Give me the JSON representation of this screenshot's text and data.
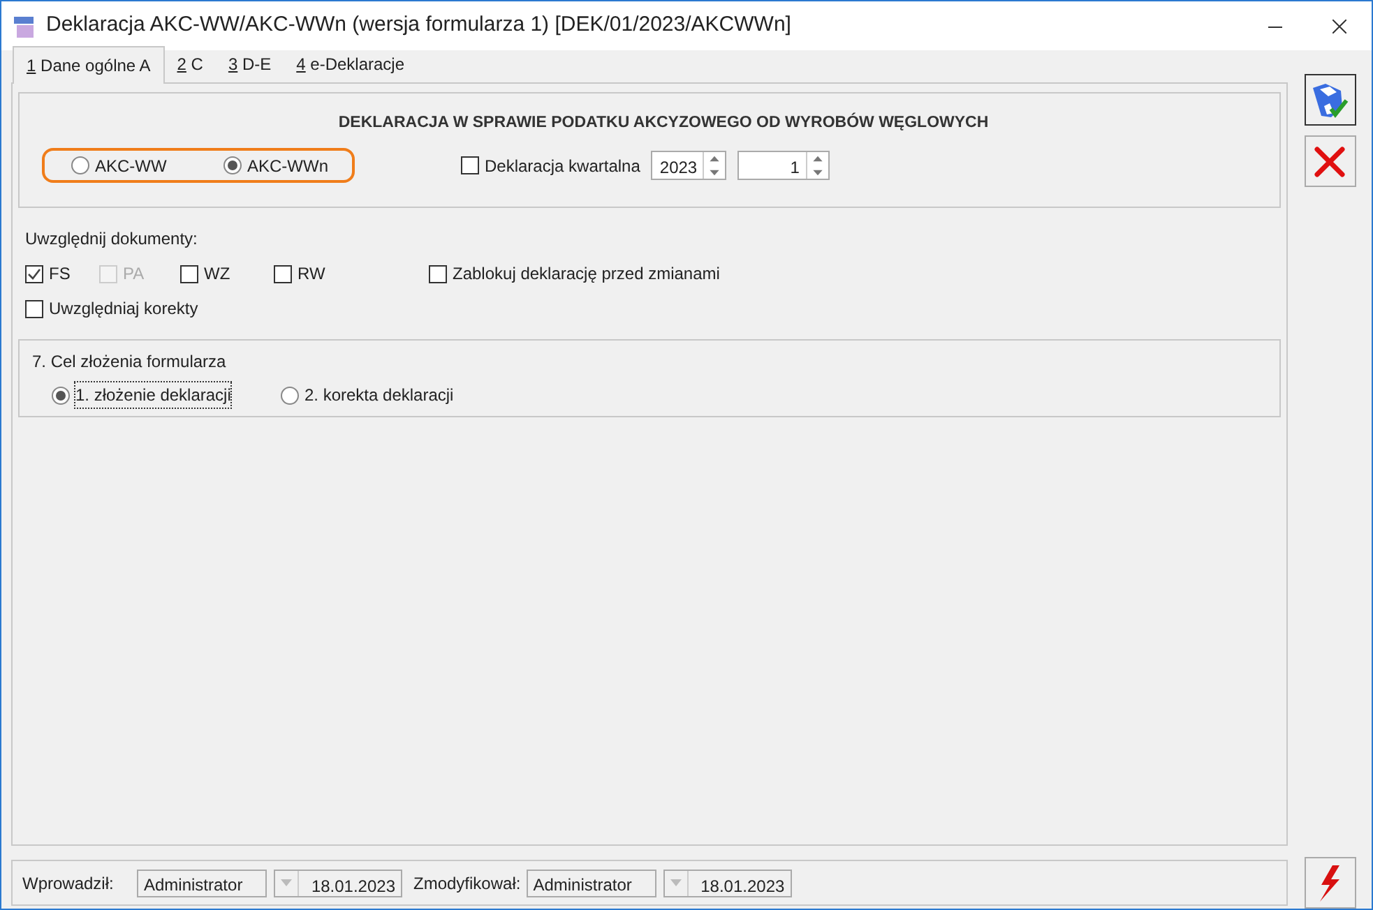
{
  "window": {
    "title": "Deklaracja AKC-WW/AKC-WWn (wersja formularza 1) [DEK/01/2023/AKCWWn]"
  },
  "tabs": [
    {
      "key": "1",
      "label": "Dane ogólne A",
      "selected": true
    },
    {
      "key": "2",
      "label": "C",
      "selected": false
    },
    {
      "key": "3",
      "label": "D-E",
      "selected": false
    },
    {
      "key": "4",
      "label": "e-Deklaracje",
      "selected": false
    }
  ],
  "header": {
    "title": "DEKLARACJA W SPRAWIE PODATKU AKCYZOWEGO OD WYROBÓW WĘGLOWYCH",
    "highlighted": true,
    "form_types": [
      {
        "label": "AKC-WW",
        "selected": false
      },
      {
        "label": "AKC-WWn",
        "selected": true
      }
    ],
    "quarterly": {
      "label": "Deklaracja kwartalna",
      "checked": false
    },
    "year": "2023",
    "period": "1"
  },
  "documents": {
    "label": "Uwzględnij dokumenty:",
    "types": [
      {
        "label": "FS",
        "checked": true,
        "disabled": false
      },
      {
        "label": "PA",
        "checked": false,
        "disabled": true
      },
      {
        "label": "WZ",
        "checked": false,
        "disabled": false
      },
      {
        "label": "RW",
        "checked": false,
        "disabled": false
      }
    ],
    "lock": {
      "label": "Zablokuj deklarację przed zmianami",
      "checked": false
    },
    "corrections": {
      "label": "Uwzględniaj korekty",
      "checked": false
    }
  },
  "purpose": {
    "title": "7. Cel złożenia formularza",
    "options": [
      {
        "label": "1. złożenie deklaracji",
        "selected": true
      },
      {
        "label": "2. korekta deklaracji",
        "selected": false
      }
    ]
  },
  "footer": {
    "entered_label": "Wprowadził:",
    "entered_by": "Administrator",
    "entered_date": "18.01.2023",
    "modified_label": "Zmodyfikował:",
    "modified_by": "Administrator",
    "modified_date": "18.01.2023"
  }
}
